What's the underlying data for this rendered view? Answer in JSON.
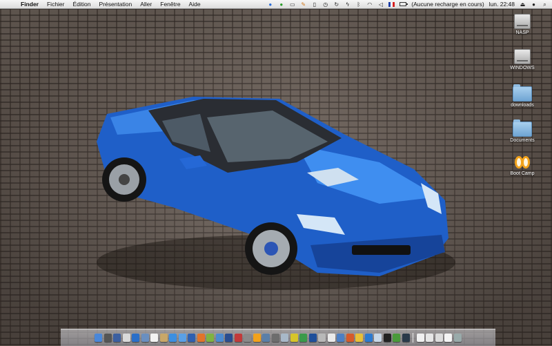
{
  "menubar": {
    "apple_icon": "apple-icon",
    "items": [
      "Finder",
      "Fichier",
      "Édition",
      "Présentation",
      "Aller",
      "Fenêtre",
      "Aide"
    ],
    "battery_status": "(Aucune recharge en cours)",
    "clock": "lun. 22:48"
  },
  "desktop_icons": [
    {
      "label": "NASP",
      "icon": "hard-drive-icon"
    },
    {
      "label": "WINDOWS",
      "icon": "hard-drive-icon"
    },
    {
      "label": "downloads",
      "icon": "folder-icon"
    },
    {
      "label": "Documents",
      "icon": "folder-icon"
    },
    {
      "label": "Boot Camp",
      "icon": "boot-camp-icon"
    }
  ],
  "colors": {
    "car_body": "#1f5fc8",
    "car_highlight": "#4f9bf0",
    "menubar": "#e8e8e8"
  }
}
